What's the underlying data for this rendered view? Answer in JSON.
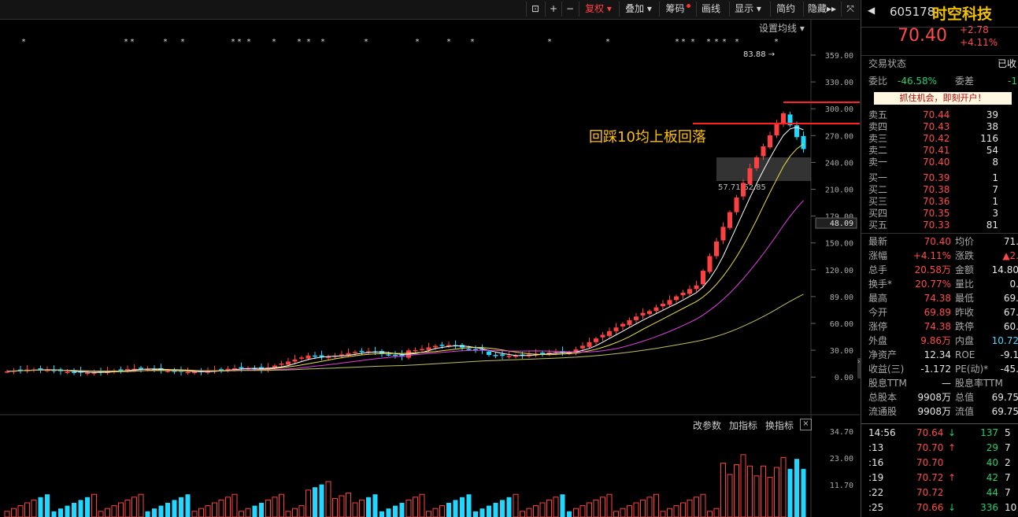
{
  "toolbar": {
    "buttons": [
      "复权",
      "叠加",
      "筹码",
      "画线",
      "显示",
      "简约",
      "隐藏"
    ],
    "ma_settings": "设置均线"
  },
  "chart": {
    "y_labels": [
      "359.00",
      "330.00",
      "300.00",
      "270.00",
      "240.00",
      "210.00",
      "179.00",
      "150.00",
      "120.00",
      "89.00",
      "60.00",
      "30.00",
      "0.00"
    ],
    "cursor_value": "48.09",
    "high_marker": "83.88",
    "zone_label": "57.71-62.85",
    "annotation": "回踩10均上板回落",
    "vol_labels": [
      "34.70",
      "23.00",
      "11.70"
    ],
    "panel_buttons": [
      "改参数",
      "加指标",
      "换指标"
    ],
    "colors": {
      "up": "#ff4040",
      "down": "#20d8ff",
      "ma5": "#ffffff",
      "ma10": "#f0e040",
      "ma20": "#e040e0",
      "ma60": "#c0c060"
    }
  },
  "quote": {
    "code": "605178",
    "name": "时空科技",
    "price": "70.40",
    "change": "+2.78",
    "change_pct": "+4.11%",
    "status_label": "交易状态",
    "status_value": "已收",
    "weibi_label": "委比",
    "weibi_value": "-46.58%",
    "weicha_label": "委差",
    "weicha_value": "-1",
    "promo": "抓住机会，即刻开户！"
  },
  "orderbook": {
    "asks": [
      {
        "label": "卖五",
        "price": "70.44",
        "vol": "39"
      },
      {
        "label": "卖四",
        "price": "70.43",
        "vol": "38"
      },
      {
        "label": "卖三",
        "price": "70.42",
        "vol": "116"
      },
      {
        "label": "卖二",
        "price": "70.41",
        "vol": "54"
      },
      {
        "label": "卖一",
        "price": "70.40",
        "vol": "8"
      }
    ],
    "bids": [
      {
        "label": "买一",
        "price": "70.39",
        "vol": "1"
      },
      {
        "label": "买二",
        "price": "70.38",
        "vol": "7"
      },
      {
        "label": "买三",
        "price": "70.36",
        "vol": "1"
      },
      {
        "label": "买四",
        "price": "70.35",
        "vol": "3"
      },
      {
        "label": "买五",
        "price": "70.33",
        "vol": "81"
      }
    ]
  },
  "stats": [
    {
      "l1": "最新",
      "v1": "70.40",
      "l2": "均价",
      "v2": "71."
    },
    {
      "l1": "涨幅",
      "v1": "+4.11%",
      "l2": "涨跌",
      "v2": "▲2."
    },
    {
      "l1": "总手",
      "v1": "20.58万",
      "l2": "金额",
      "v2": "14.80"
    },
    {
      "l1": "换手*",
      "v1": "20.77%",
      "l2": "量比",
      "v2": "0."
    },
    {
      "l1": "最高",
      "v1": "74.38",
      "l2": "最低",
      "v2": "69."
    },
    {
      "l1": "今开",
      "v1": "69.89",
      "l2": "昨收",
      "v2": "67."
    },
    {
      "l1": "涨停",
      "v1": "74.38",
      "l2": "跌停",
      "v2": "60."
    },
    {
      "l1": "外盘",
      "v1": "9.86万",
      "l2": "内盘",
      "v2": "10.72"
    },
    {
      "l1": "净资产",
      "v1": "12.34",
      "l2": "ROE",
      "v2": "-9.1"
    },
    {
      "l1": "收益(三)",
      "v1": "-1.172",
      "l2": "PE(动)*",
      "v2": "-45."
    },
    {
      "l1": "股息TTM",
      "v1": "—",
      "l2": "股息率TTM",
      "v2": ""
    },
    {
      "l1": "总股本",
      "v1": "9908万",
      "l2": "总值",
      "v2": "69.75"
    },
    {
      "l1": "流通股",
      "v1": "9908万",
      "l2": "流值",
      "v2": "69.75"
    }
  ],
  "ticks": [
    {
      "time": "14:56",
      "price": "70.64",
      "arrow": "↓",
      "vol": "137",
      "extra": "5"
    },
    {
      "time": ":13",
      "price": "70.70",
      "arrow": "↑",
      "vol": "29",
      "extra": "7"
    },
    {
      "time": ":16",
      "price": "70.70",
      "arrow": "",
      "vol": "40",
      "extra": "2"
    },
    {
      "time": ":19",
      "price": "70.72",
      "arrow": "↑",
      "vol": "42",
      "extra": "7"
    },
    {
      "time": ":22",
      "price": "70.72",
      "arrow": "",
      "vol": "44",
      "extra": "7"
    },
    {
      "time": ":25",
      "price": "70.66",
      "arrow": "↓",
      "vol": "336",
      "extra": "10"
    }
  ]
}
